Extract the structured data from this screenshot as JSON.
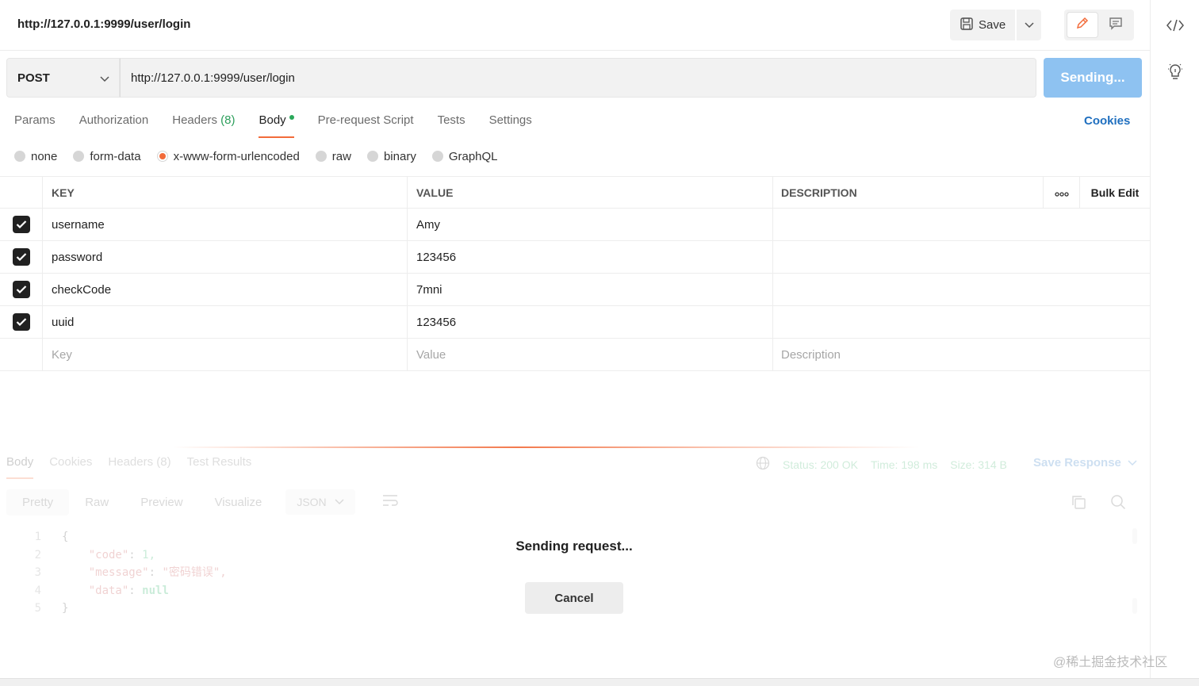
{
  "header": {
    "title": "http://127.0.0.1:9999/user/login",
    "save_label": "Save"
  },
  "request": {
    "method": "POST",
    "url": "http://127.0.0.1:9999/user/login",
    "send_label": "Sending..."
  },
  "req_tabs": {
    "params": "Params",
    "authorization": "Authorization",
    "headers": "Headers",
    "headers_count": "(8)",
    "body": "Body",
    "prerequest": "Pre-request Script",
    "tests": "Tests",
    "settings": "Settings",
    "cookies": "Cookies"
  },
  "body_types": {
    "none": "none",
    "form_data": "form-data",
    "urlencoded": "x-www-form-urlencoded",
    "raw": "raw",
    "binary": "binary",
    "graphql": "GraphQL",
    "selected": "x-www-form-urlencoded"
  },
  "table": {
    "headers": {
      "key": "KEY",
      "value": "VALUE",
      "description": "DESCRIPTION",
      "more": "ooo",
      "bulk_edit": "Bulk Edit"
    },
    "rows": [
      {
        "key": "username",
        "value": "Amy"
      },
      {
        "key": "password",
        "value": "123456"
      },
      {
        "key": "checkCode",
        "value": "7mni"
      },
      {
        "key": "uuid",
        "value": "123456"
      }
    ],
    "placeholders": {
      "key": "Key",
      "value": "Value",
      "description": "Description"
    }
  },
  "response": {
    "tabs": {
      "body": "Body",
      "cookies": "Cookies",
      "headers": "Headers (8)",
      "test_results": "Test Results"
    },
    "status": "Status: 200 OK",
    "time": "Time: 198 ms",
    "size": "Size: 314 B",
    "save_response": "Save Response",
    "views": {
      "pretty": "Pretty",
      "raw": "Raw",
      "preview": "Preview",
      "visualize": "Visualize",
      "format": "JSON"
    },
    "code": {
      "line1": "{",
      "line2_key": "\"code\"",
      "line2_val": "1,",
      "line3_key": "\"message\"",
      "line3_val": "\"密码错误\",",
      "line4_key": "\"data\"",
      "line4_val": "null",
      "line5": "}",
      "numbers": [
        "1",
        "2",
        "3",
        "4",
        "5"
      ]
    }
  },
  "overlay": {
    "sending_text": "Sending request...",
    "cancel_label": "Cancel"
  },
  "watermark": "@稀土掘金技术社区",
  "colors": {
    "accent": "#f26b3a",
    "send_disabled": "#8ec2f1",
    "link": "#1f6fbf"
  }
}
